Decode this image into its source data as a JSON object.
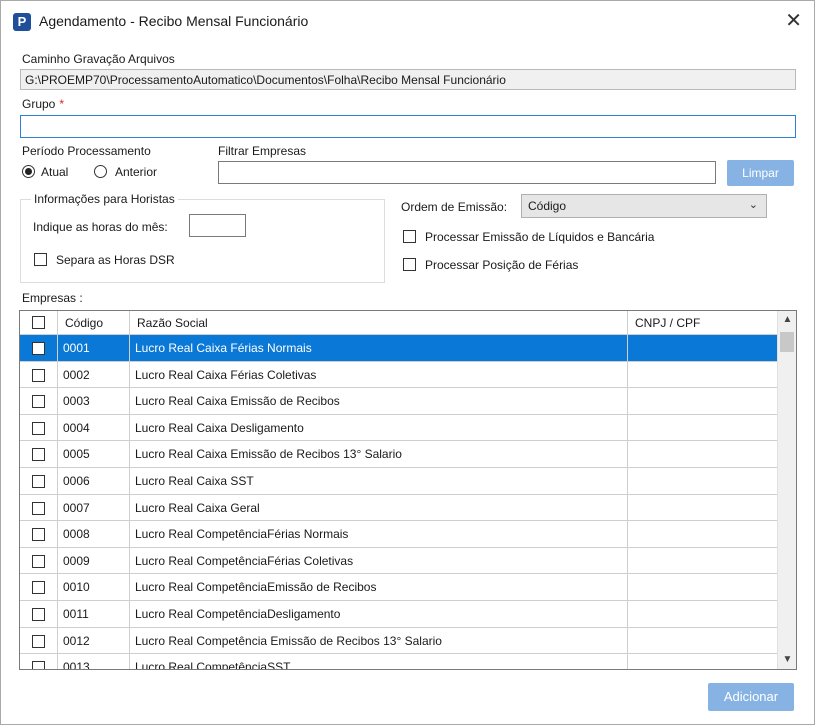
{
  "window": {
    "app_icon": "P",
    "title": "Agendamento - Recibo Mensal Funcionário",
    "close_glyph": "✕"
  },
  "caminho": {
    "label": "Caminho Gravação Arquivos",
    "value": "G:\\PROEMP70\\ProcessamentoAutomatico\\Documentos\\Folha\\Recibo Mensal Funcionário"
  },
  "grupo": {
    "label": "Grupo",
    "required_mark": "*",
    "value": ""
  },
  "periodo": {
    "label": "Período Processamento",
    "options": [
      "Atual",
      "Anterior"
    ],
    "selected": "Atual"
  },
  "filtro": {
    "label": "Filtrar Empresas",
    "value": "",
    "button": "Limpar"
  },
  "horistas": {
    "title": "Informações para Horistas",
    "horas_label": "Indique as horas do mês:",
    "horas_value": "",
    "dsr_label": "Separa as Horas DSR"
  },
  "ordem": {
    "label": "Ordem de Emissão:",
    "value": "Código"
  },
  "opcoes": {
    "liquidos": "Processar Emissão de Líquidos e Bancária",
    "ferias": "Processar Posição de Férias"
  },
  "empresas": {
    "label": "Empresas :",
    "columns": [
      "Código",
      "Razão Social",
      "CNPJ / CPF"
    ],
    "rows": [
      {
        "codigo": "0001",
        "razao": "Lucro Real Caixa Férias Normais",
        "cnpj": ""
      },
      {
        "codigo": "0002",
        "razao": "Lucro Real Caixa Férias Coletivas",
        "cnpj": ""
      },
      {
        "codigo": "0003",
        "razao": "Lucro Real Caixa Emissão de Recibos",
        "cnpj": ""
      },
      {
        "codigo": "0004",
        "razao": "Lucro Real Caixa Desligamento",
        "cnpj": ""
      },
      {
        "codigo": "0005",
        "razao": "Lucro Real Caixa Emissão de Recibos 13° Salario",
        "cnpj": ""
      },
      {
        "codigo": "0006",
        "razao": "Lucro Real Caixa SST",
        "cnpj": ""
      },
      {
        "codigo": "0007",
        "razao": "Lucro Real Caixa Geral",
        "cnpj": ""
      },
      {
        "codigo": "0008",
        "razao": "Lucro Real CompetênciaFérias Normais",
        "cnpj": ""
      },
      {
        "codigo": "0009",
        "razao": "Lucro Real CompetênciaFérias Coletivas",
        "cnpj": ""
      },
      {
        "codigo": "0010",
        "razao": "Lucro Real CompetênciaEmissão de Recibos",
        "cnpj": ""
      },
      {
        "codigo": "0011",
        "razao": "Lucro Real CompetênciaDesligamento",
        "cnpj": ""
      },
      {
        "codigo": "0012",
        "razao": "Lucro Real Competência Emissão de Recibos 13° Salario",
        "cnpj": ""
      },
      {
        "codigo": "0013",
        "razao": "Lucro Real CompetênciaSST",
        "cnpj": ""
      }
    ],
    "selected_index": 0
  },
  "footer": {
    "adicionar": "Adicionar"
  },
  "colors": {
    "accent": "#0a78d7",
    "button": "#86b3e3",
    "focus": "#2f7fd8"
  }
}
